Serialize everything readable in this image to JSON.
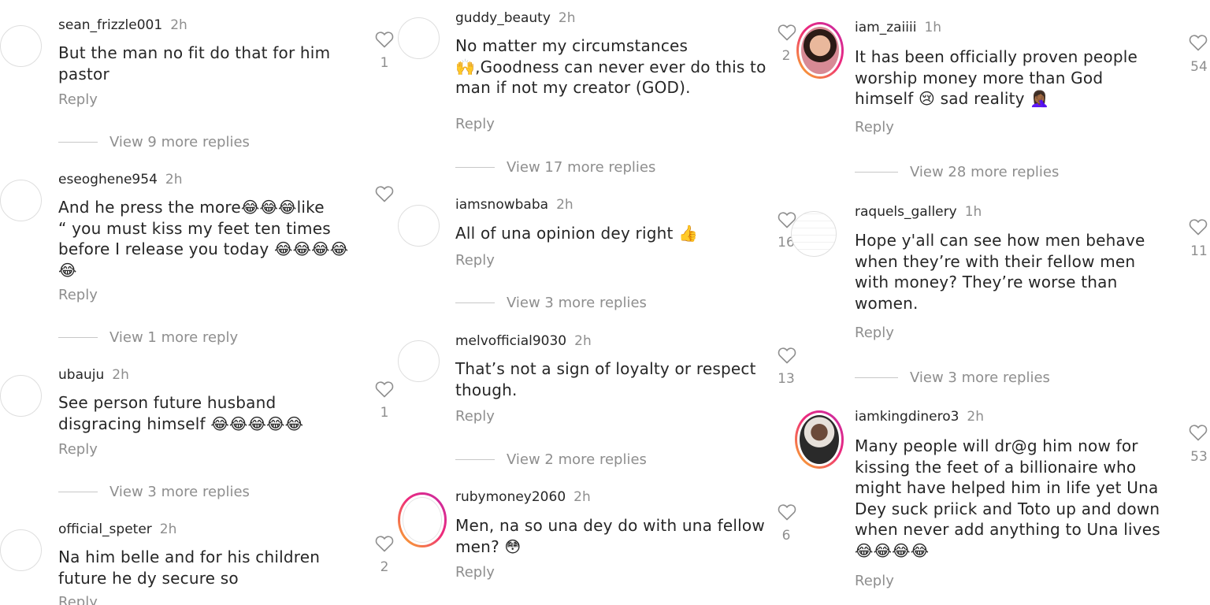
{
  "col1": {
    "c1": {
      "user": "sean_frizzle001",
      "time": "2h",
      "lines": [
        "But the man no fit do that for him",
        "pastor"
      ],
      "reply": "Reply",
      "likes": "1",
      "view_more": "View 9 more replies"
    },
    "c2": {
      "user": "eseoghene954",
      "time": "2h",
      "lines": [
        "And he press the more😂😂😂like",
        "“ you must kiss my feet ten times",
        "before I release you today 😂😂😂😂",
        "😂"
      ],
      "reply": "Reply",
      "view_more": "View 1 more reply"
    },
    "c3": {
      "user": "ubauju",
      "time": "2h",
      "lines": [
        "See  person future husband",
        "disgracing himself 😂😂😂😂😂"
      ],
      "reply": "Reply",
      "likes": "1",
      "view_more": "View 3 more replies"
    },
    "c4": {
      "user": "official_speter",
      "time": "2h",
      "lines": [
        "Na him belle and for his children",
        "future he dy secure so"
      ],
      "reply": "Reply",
      "likes": "2"
    }
  },
  "col2": {
    "c1": {
      "user": "guddy_beauty",
      "time": "2h",
      "lines": [
        "No matter my circumstances",
        "🙌,Goodness can never ever do this to",
        "man if not my creator (GOD)."
      ],
      "reply": "Reply",
      "view_more": "View 17 more replies"
    },
    "c2": {
      "user": "iamsnowbaba",
      "time": "2h",
      "lines": [
        "All of una opinion dey right 👍"
      ],
      "reply": "Reply",
      "view_more": "View 3 more replies"
    },
    "c3": {
      "user": "melvofficial9030",
      "time": "2h",
      "lines": [
        "That’s not a sign of loyalty or respect",
        "though."
      ],
      "reply": "Reply",
      "view_more": "View 2 more replies"
    },
    "c4": {
      "user": "rubymoney2060",
      "time": "2h",
      "lines": [
        "Men, na so una dey do with una fellow",
        "men? 😳"
      ],
      "reply": "Reply"
    }
  },
  "col3": {
    "c1": {
      "user": "iam_zaiiii",
      "time": "1h",
      "lines": [
        "It has been officially proven people",
        "worship money more than God",
        "himself 😢 sad reality 🤦🏾‍♀️"
      ],
      "reply": "Reply",
      "likes": "54",
      "prev_likes": "2",
      "view_more": "View 28 more replies"
    },
    "c2": {
      "user": "raquels_gallery",
      "time": "1h",
      "lines": [
        "Hope y'all can see how men behave",
        "when they’re with their fellow men",
        "with money? They’re worse than",
        "women."
      ],
      "reply": "Reply",
      "likes": "11",
      "prev_likes": "16",
      "view_more": "View 3 more replies"
    },
    "c3": {
      "user": "iamkingdinero3",
      "time": "2h",
      "lines": [
        "Many people will dr@g him now for",
        "kissing the feet of a billionaire who",
        "might have helped him in life yet Una",
        "Dey suck priick and Toto up and down",
        "when never add anything to Una lives",
        "😂😂😂😂"
      ],
      "reply": "Reply",
      "likes": "53",
      "prev_likes": "13",
      "extra_likes": "6"
    }
  },
  "colors": {
    "text": "#262626",
    "muted": "#8e8e8e",
    "ring_start": "#f9b526",
    "ring_end": "#c42ca7"
  },
  "icons": {
    "like": "heart-outline-icon"
  }
}
